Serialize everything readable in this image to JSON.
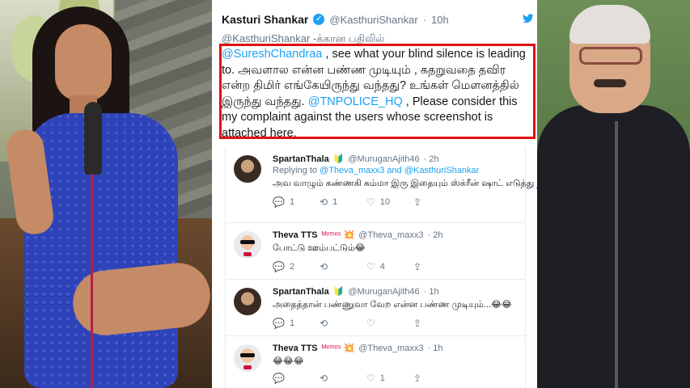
{
  "tweet": {
    "author_name": "Kasturi Shankar",
    "author_handle": "@KasthuriShankar",
    "age": "10h",
    "reply_context": "@KasthuriShankar -க்கான பதிலில்",
    "text": {
      "part1_mention": "@SureshChandraa",
      "part1": " , see  what your blind silence is leading to. அவளால என்ன பண்ண முடியும் , கதறுவதை தவிர என்ற திமிர் எங்கேயிருந்து வந்தது? உங்கள் மௌனத்தில் இருந்து வந்தது. ",
      "part2_mention": "@TNPOLICE_HQ",
      "part2": " , Please consider this my complaint against the users whose screenshot is attached here."
    }
  },
  "replies": [
    {
      "name": "SpartanThala",
      "badge": "🔰",
      "handle": "@MuruganAjith46",
      "age": "· 2h",
      "replying_prefix": "Replying to ",
      "replying_mentions": "@Theva_maxx3 and @KasthuriShankar",
      "text": "அவ வாழும் கண்ணகி சும்மா இரு இதையும் ஸ்க்ரீன் ஷாட் எடுத்து நாளைக்கு போடுவா...😜😝",
      "counts": {
        "reply": "1",
        "retweet": "1",
        "like": "10"
      }
    },
    {
      "name": "Theva TTS",
      "badge": "ᴹᵉᵐᵉˢ 💥",
      "handle": "@Theva_maxx3",
      "age": "· 2h",
      "text": "போட்டு ஊம்பட்டும்😂",
      "counts": {
        "reply": "2",
        "retweet": "",
        "like": "4"
      }
    },
    {
      "name": "SpartanThala",
      "badge": "🔰",
      "handle": "@MuruganAjith46",
      "age": "· 1h",
      "text": "அதைத்தான் பண்ணுவா வேற என்ன பண்ண முடியும்...😂😂",
      "counts": {
        "reply": "1",
        "retweet": "",
        "like": ""
      }
    },
    {
      "name": "Theva TTS",
      "badge": "ᴹᵉᵐᵉˢ 💥",
      "handle": "@Theva_maxx3",
      "age": "· 1h",
      "text": "😂😂😂",
      "counts": {
        "reply": "",
        "retweet": "",
        "like": "1"
      }
    }
  ],
  "icons": {
    "reply": "reply-icon",
    "retweet": "retweet-icon",
    "like": "heart-icon",
    "share": "share-icon",
    "verified": "verified-badge-icon",
    "twitter": "twitter-bird-icon"
  },
  "colors": {
    "accent_blue": "#1da1f2",
    "highlight_red": "#e01010"
  }
}
